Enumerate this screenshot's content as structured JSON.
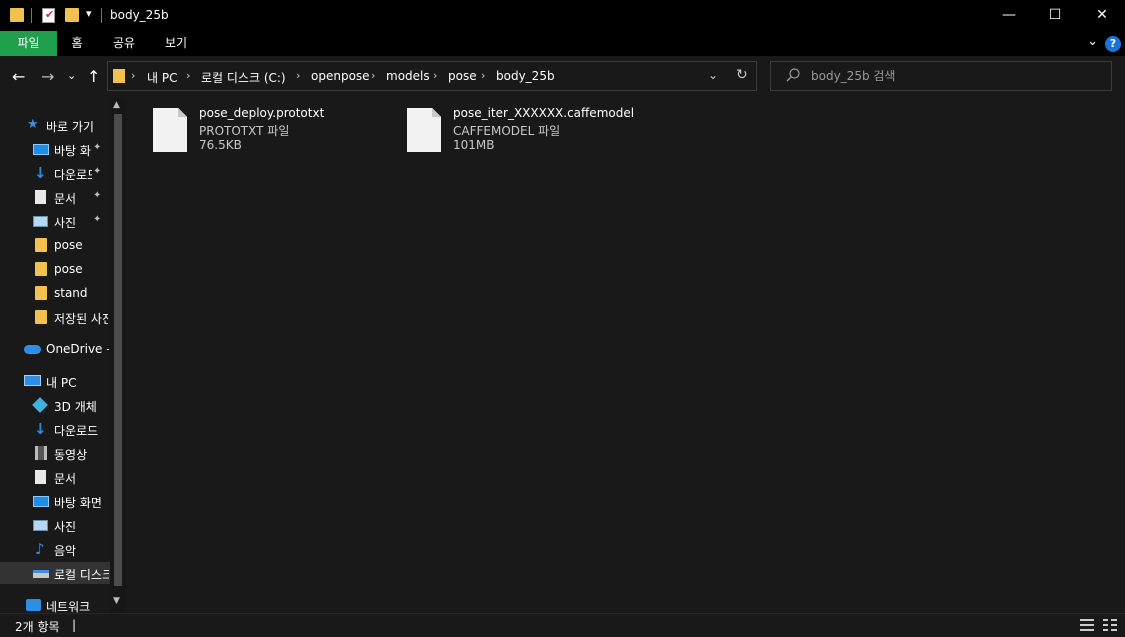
{
  "window": {
    "title": "body_25b",
    "minimize_glyph": "—",
    "maximize_glyph": "☐",
    "close_glyph": "✕",
    "quick_access_dropdown": "▾"
  },
  "ribbon": {
    "tabs": [
      "파일",
      "홈",
      "공유",
      "보기"
    ],
    "expand_glyph": "⌄",
    "help_label": "?",
    "accent_color": "#1f9e4b"
  },
  "navigation": {
    "back": "←",
    "forward": "→",
    "recent": "⌄",
    "up": "↑"
  },
  "address": {
    "crumbs": [
      "내 PC",
      "로컬 디스크 (C:)",
      "openpose",
      "models",
      "pose",
      "body_25b"
    ],
    "separator": "›",
    "dropdown": "⌄",
    "refresh": "↻"
  },
  "search": {
    "placeholder": "body_25b 검색",
    "icon": "search-icon"
  },
  "sidebar": {
    "quick_access": {
      "label": "바로 가기",
      "icon": "star-icon"
    },
    "pinned": [
      {
        "label": "바탕 화면",
        "icon": "desktop-icon"
      },
      {
        "label": "다운로드",
        "icon": "download-icon"
      },
      {
        "label": "문서",
        "icon": "document-icon"
      },
      {
        "label": "사진",
        "icon": "pictures-icon"
      }
    ],
    "recent": [
      {
        "label": "pose",
        "icon": "folder-icon"
      },
      {
        "label": "pose",
        "icon": "folder-icon"
      },
      {
        "label": "stand",
        "icon": "folder-icon"
      },
      {
        "label": "저장된 사진",
        "icon": "folder-icon"
      }
    ],
    "onedrive": {
      "label": "OneDrive - Personal",
      "icon": "cloud-icon"
    },
    "this_pc": {
      "label": "내 PC",
      "icon": "computer-icon"
    },
    "pc_items": [
      {
        "label": "3D 개체",
        "icon": "cube-icon"
      },
      {
        "label": "다운로드",
        "icon": "download-icon"
      },
      {
        "label": "동영상",
        "icon": "video-icon"
      },
      {
        "label": "문서",
        "icon": "document-icon"
      },
      {
        "label": "바탕 화면",
        "icon": "desktop-icon"
      },
      {
        "label": "사진",
        "icon": "pictures-icon"
      },
      {
        "label": "음악",
        "icon": "music-icon"
      },
      {
        "label": "로컬 디스크 (C:)",
        "icon": "drive-icon"
      }
    ],
    "network": {
      "label": "네트워크",
      "icon": "network-icon"
    },
    "pin_glyph": "📌"
  },
  "files": [
    {
      "name": "pose_deploy.prototxt",
      "type": "PROTOTXT 파일",
      "size": "76.5KB"
    },
    {
      "name": "pose_iter_XXXXXX.caffemodel",
      "type": "CAFFEMODEL 파일",
      "size": "101MB"
    }
  ],
  "status": {
    "item_count": "2개 항목",
    "separator": "|"
  }
}
